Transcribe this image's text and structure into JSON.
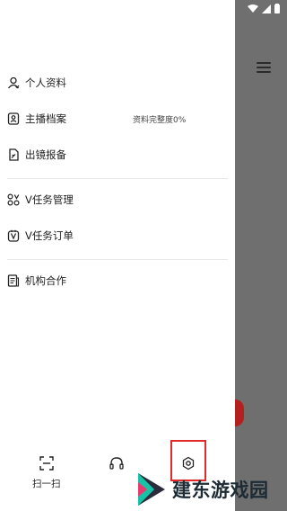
{
  "menu": {
    "items": [
      {
        "label": "个人资料",
        "icon": "user-icon"
      },
      {
        "label": "主播档案",
        "icon": "id-card-icon",
        "extra": "资料完整度0%"
      },
      {
        "label": "出镜报备",
        "icon": "report-icon"
      },
      {
        "label": "V任务管理",
        "icon": "task-manage-icon"
      },
      {
        "label": "V任务订单",
        "icon": "task-order-icon"
      },
      {
        "label": "机构合作",
        "icon": "document-icon"
      }
    ]
  },
  "bottom_bar": {
    "scan_label": "扫一扫",
    "support_icon": "headset-icon",
    "settings_icon": "settings-icon"
  },
  "watermark": {
    "text": "建东游戏园"
  },
  "colors": {
    "highlight_box": "#e22a2a",
    "overlay": "#6f6f6f",
    "accent_red": "#b22020"
  }
}
